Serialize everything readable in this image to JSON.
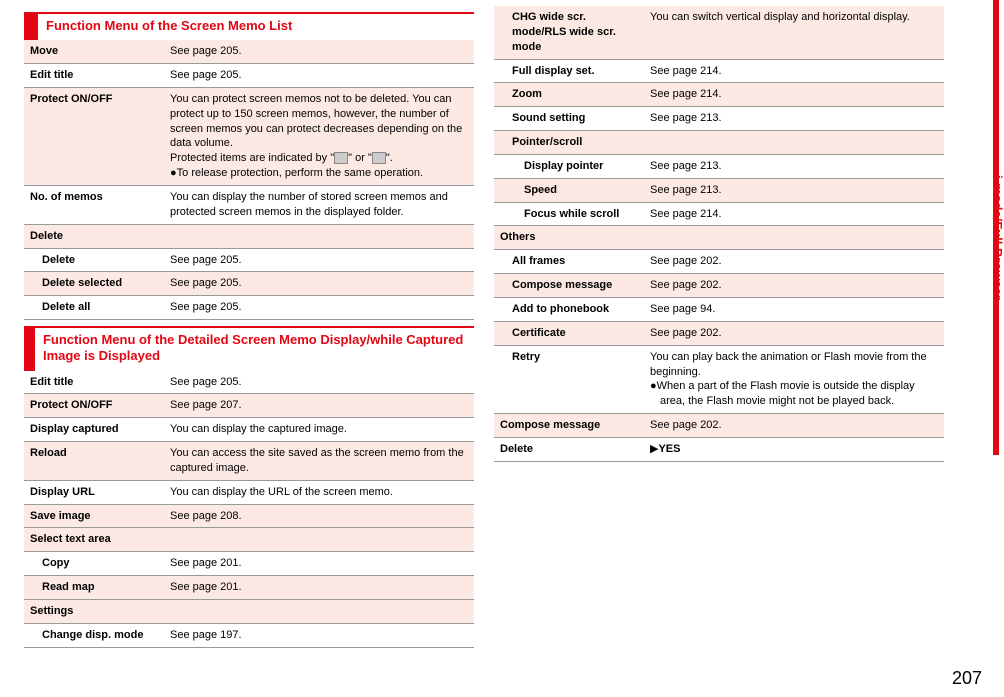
{
  "sideTab": "i-mode/Full Browser",
  "pageNumber": "207",
  "sec1": {
    "title": "Function Menu of the Screen Memo List",
    "rows": {
      "move": {
        "label": "Move",
        "desc": "See page 205."
      },
      "editTitle": {
        "label": "Edit title",
        "desc": "See page 205."
      },
      "protect": {
        "label": "Protect ON/OFF",
        "desc1": "You can protect screen memos not to be deleted. You can protect up to 150 screen memos, however, the number of screen memos you can protect decreases depending on the data volume.",
        "desc2a": "Protected items are indicated by \"",
        "desc2b": "\" or \"",
        "desc2c": "\".",
        "bullet": "●To release protection, perform the same operation."
      },
      "noMemos": {
        "label": "No. of memos",
        "desc": "You can display the number of stored screen memos and protected screen memos in the displayed folder."
      },
      "deleteHead": "Delete",
      "delete": {
        "label": "Delete",
        "desc": "See page 205."
      },
      "deleteSelected": {
        "label": "Delete selected",
        "desc": "See page 205."
      },
      "deleteAll": {
        "label": "Delete all",
        "desc": "See page 205."
      }
    }
  },
  "sec2": {
    "title": "Function Menu of the Detailed Screen Memo Display/while Captured Image is Displayed",
    "rows": {
      "editTitle": {
        "label": "Edit title",
        "desc": "See page 205."
      },
      "protect": {
        "label": "Protect ON/OFF",
        "desc": "See page 207."
      },
      "displayCaptured": {
        "label": "Display captured",
        "desc": "You can display the captured image."
      },
      "reload": {
        "label": "Reload",
        "desc": "You can access the site saved as the screen memo from the captured image."
      },
      "displayUrl": {
        "label": "Display URL",
        "desc": "You can display the URL of the screen memo."
      },
      "saveImage": {
        "label": "Save image",
        "desc": "See page 208."
      },
      "selectTextHead": "Select text area",
      "copy": {
        "label": "Copy",
        "desc": "See page 201."
      },
      "readMap": {
        "label": "Read map",
        "desc": "See page 201."
      },
      "settingsHead": "Settings",
      "changeDisp": {
        "label": "Change disp. mode",
        "desc": "See page 197."
      },
      "chgWide": {
        "label": "CHG wide scr. mode/RLS wide scr. mode",
        "desc": "You can switch vertical display and horizontal display."
      },
      "fullDisplay": {
        "label": "Full display set.",
        "desc": "See page 214."
      },
      "zoom": {
        "label": "Zoom",
        "desc": "See page 214."
      },
      "soundSetting": {
        "label": "Sound setting",
        "desc": "See page 213."
      },
      "pointerHead": "Pointer/scroll",
      "displayPointer": {
        "label": "Display pointer",
        "desc": "See page 213."
      },
      "speed": {
        "label": "Speed",
        "desc": "See page 213."
      },
      "focusScroll": {
        "label": "Focus while scroll",
        "desc": "See page 214."
      },
      "othersHead": "Others",
      "allFrames": {
        "label": "All frames",
        "desc": "See page 202."
      },
      "composeMsg1": {
        "label": "Compose message",
        "desc": "See page 202."
      },
      "addPhonebook": {
        "label": "Add to phonebook",
        "desc": "See page 94."
      },
      "certificate": {
        "label": "Certificate",
        "desc": "See page 202."
      },
      "retry": {
        "label": "Retry",
        "desc": "You can play back the animation or Flash movie from the beginning.",
        "bullet": "●When a part of the Flash movie is outside the display area, the Flash movie might not be played back."
      },
      "composeMsg2": {
        "label": "Compose message",
        "desc": "See page 202."
      },
      "delete": {
        "label": "Delete",
        "arrow": "▶",
        "yes": "YES"
      }
    }
  }
}
